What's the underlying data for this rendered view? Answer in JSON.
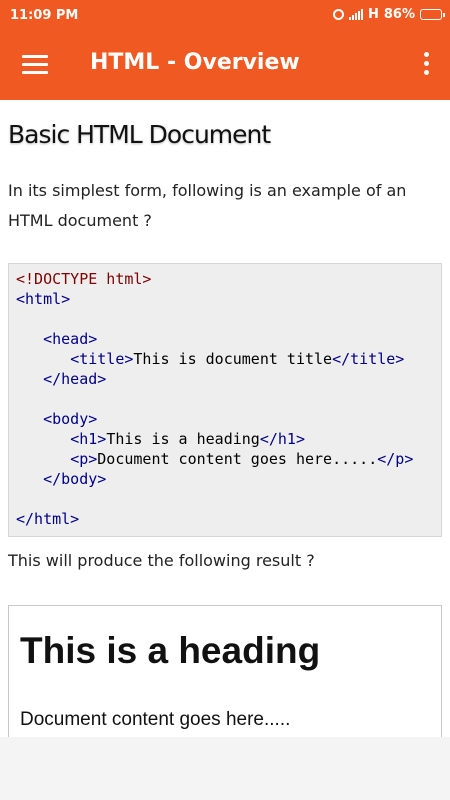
{
  "status_bar": {
    "time": "11:09 PM",
    "network": "H",
    "battery": "86%",
    "battery_level": 0.86,
    "icons": [
      "alarm-icon",
      "signal-icon",
      "battery-icon"
    ]
  },
  "app_bar": {
    "title": "HTML - Overview",
    "color": "#f05a22",
    "icons": [
      "menu-icon",
      "more-vert-icon"
    ]
  },
  "main": {
    "heading": "Basic HTML Document",
    "intro": "In its simplest form, following is an example of an HTML document ?",
    "code_lines": [
      [
        {
          "t": "<!DOCTYPE html>",
          "c": "doctype"
        }
      ],
      [
        {
          "t": "<html>",
          "c": "tag"
        }
      ],
      [],
      [
        {
          "t": "   ",
          "c": "txt"
        },
        {
          "t": "<head>",
          "c": "tag"
        }
      ],
      [
        {
          "t": "      ",
          "c": "txt"
        },
        {
          "t": "<title>",
          "c": "tag"
        },
        {
          "t": "This is document title",
          "c": "txt"
        },
        {
          "t": "</title>",
          "c": "tag"
        }
      ],
      [
        {
          "t": "   ",
          "c": "txt"
        },
        {
          "t": "</head>",
          "c": "tag"
        }
      ],
      [],
      [
        {
          "t": "   ",
          "c": "txt"
        },
        {
          "t": "<body>",
          "c": "tag"
        }
      ],
      [
        {
          "t": "      ",
          "c": "txt"
        },
        {
          "t": "<h1>",
          "c": "tag"
        },
        {
          "t": "This is a heading",
          "c": "txt"
        },
        {
          "t": "</h1>",
          "c": "tag"
        }
      ],
      [
        {
          "t": "      ",
          "c": "txt"
        },
        {
          "t": "<p>",
          "c": "tag"
        },
        {
          "t": "Document content goes here.....",
          "c": "txt"
        },
        {
          "t": "</p>",
          "c": "tag"
        }
      ],
      [
        {
          "t": "   ",
          "c": "txt"
        },
        {
          "t": "</body>",
          "c": "tag"
        }
      ],
      [],
      [
        {
          "t": "</html>",
          "c": "tag"
        }
      ]
    ],
    "result_label": "This will produce the following result ?",
    "result": {
      "heading": "This is a heading",
      "paragraph": "Document content goes here....."
    }
  }
}
